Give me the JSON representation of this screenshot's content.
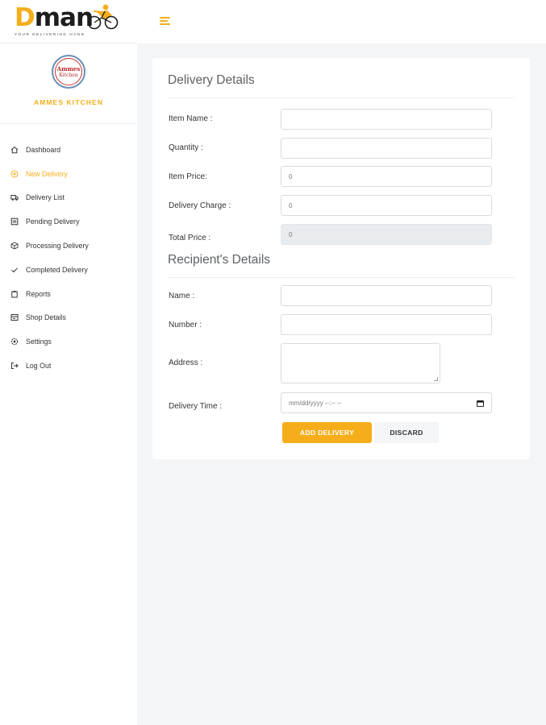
{
  "brand": {
    "logo_text": "Dman",
    "logo_first": "D",
    "logo_rest": "man",
    "tagline": "YOUR DELIVERING HAND",
    "accent_color": "#f5ae1a"
  },
  "shop": {
    "name": "AMMES KITCHEN",
    "logo_line1": "Ammes",
    "logo_line2": "Kitchen"
  },
  "sidebar": {
    "items": [
      {
        "label": "Dashboard",
        "icon": "home-icon",
        "active": false
      },
      {
        "label": "New Delivery",
        "icon": "plus-circle-icon",
        "active": true
      },
      {
        "label": "Delivery List",
        "icon": "truck-icon",
        "active": false
      },
      {
        "label": "Pending Delivery",
        "icon": "list-box-icon",
        "active": false
      },
      {
        "label": "Processing Delivery",
        "icon": "box-icon",
        "active": false
      },
      {
        "label": "Completed Delivery",
        "icon": "check-icon",
        "active": false
      },
      {
        "label": "Reports",
        "icon": "clipboard-icon",
        "active": false
      },
      {
        "label": "Shop Details",
        "icon": "card-icon",
        "active": false
      },
      {
        "label": "Settings",
        "icon": "gear-icon",
        "active": false
      },
      {
        "label": "Log Out",
        "icon": "logout-icon",
        "active": false
      }
    ]
  },
  "delivery_details": {
    "title": "Delivery Details",
    "item_name": {
      "label": "Item Name :",
      "value": ""
    },
    "quantity": {
      "label": "Quantity :",
      "value": ""
    },
    "item_price": {
      "label": "Item Price:",
      "value": "0"
    },
    "delivery_charge": {
      "label": "Delivery Charge :",
      "value": "0"
    },
    "total_price": {
      "label": "Total Price :",
      "value": "0"
    }
  },
  "recipient_details": {
    "title": "Recipient's Details",
    "name": {
      "label": "Name :",
      "value": ""
    },
    "number": {
      "label": "Number :",
      "value": ""
    },
    "address": {
      "label": "Address :",
      "value": ""
    },
    "delivery_time": {
      "label": "Delivery Time :",
      "placeholder": "mm/dd/yyyy --:-- --"
    }
  },
  "actions": {
    "add_label": "ADD DELIVERY",
    "discard_label": "DISCARD"
  }
}
